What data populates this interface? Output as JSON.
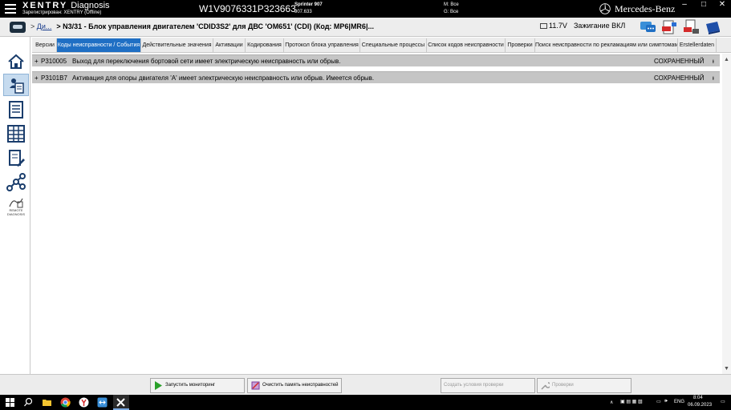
{
  "titlebar": {
    "brand": "XENTRY",
    "brand_suffix": "Diagnosis",
    "registered": "Зарегистрирован: XENTRY (Offline)",
    "vin": "W1V9076331P323663",
    "vehicle_model": "Sprinter 907",
    "vehicle_code": "907.633",
    "m_label": "М: Все",
    "g_label": "G: Все",
    "mb_name": "Mercedes-Benz"
  },
  "header": {
    "breadcrumb_link": "Ди...",
    "breadcrumb_title": "> N3/31 - Блок управления двигателем 'CDID3S2' для ДВС 'OM651' (CDI) (Код: MP6|MR6|...",
    "voltage": "11.7V",
    "ignition": "Зажигание ВКЛ"
  },
  "sidebar": {
    "remote_label_1": "REMOTE",
    "remote_label_2": "DIAGNOSIS"
  },
  "tabs": [
    {
      "label": "Версии"
    },
    {
      "label": "Коды неисправности / События"
    },
    {
      "label": "Действительные значения"
    },
    {
      "label": "Активации"
    },
    {
      "label": "Кодирования"
    },
    {
      "label": "Протокол блока управления"
    },
    {
      "label": "Специальные процессы"
    },
    {
      "label": "Список кодов неисправности"
    },
    {
      "label": "Проверки"
    },
    {
      "label": "Поиск неисправности по рекламациям или симптомам"
    },
    {
      "label": "Erstellerdaten"
    }
  ],
  "faults": [
    {
      "code": "P310005",
      "description": "Выход для переключения бортовой сети имеет электрическую неисправность или обрыв.",
      "status": "СОХРАНЕННЫЙ"
    },
    {
      "code": "P3101B7",
      "description": "Активация для опоры двигателя 'A' имеет электрическую неисправность или обрыв. Имеется обрыв.",
      "status": "СОХРАНЕННЫЙ"
    }
  ],
  "bottom": {
    "start_monitoring": "Запустить мониторинг",
    "clear_memory": "Очистить память неисправностей",
    "create_conditions": "Создать условия проверки",
    "checks": "Проверки"
  },
  "taskbar": {
    "lang": "ENG",
    "time": "8:04",
    "date": "06.09.2023"
  },
  "colors": {
    "active_tab": "#1f6fc4",
    "row_bg": "#c5c5c5",
    "titlebar": "#000000"
  }
}
